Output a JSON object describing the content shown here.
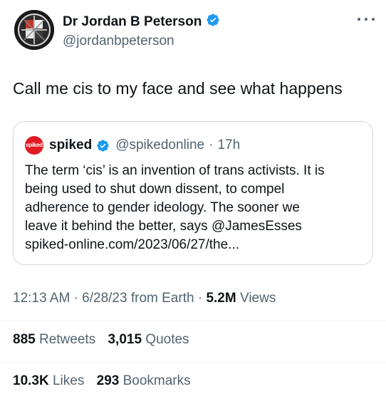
{
  "author": {
    "name": "Dr Jordan B Peterson",
    "handle": "@jordanbpeterson",
    "verified": true
  },
  "tweet": {
    "text": "Call me cis to my face and see what happens"
  },
  "quote": {
    "avatar_text": "spiked",
    "name": "spiked",
    "handle": "@spikedonline",
    "separator": "·",
    "time": "17h",
    "lines": [
      "The term ‘cis’ is an invention of trans activists. It is",
      "being used to shut down dissent, to compel",
      "adherence to gender ideology. The sooner we",
      "leave it behind the better, says @JamesEsses",
      "spiked-online.com/2023/06/27/the..."
    ]
  },
  "meta": {
    "time": "12:13 AM",
    "dot1": "·",
    "date": "6/28/23",
    "source": "from Earth",
    "dot2": "·",
    "views_count": "5.2M",
    "views_label": "Views"
  },
  "stats": {
    "retweets_count": "885",
    "retweets_label": "Retweets",
    "quotes_count": "3,015",
    "quotes_label": "Quotes",
    "likes_count": "10.3K",
    "likes_label": "Likes",
    "bookmarks_count": "293",
    "bookmarks_label": "Bookmarks"
  },
  "colors": {
    "verified": "#1d9bf0",
    "muted": "#536471",
    "text": "#0f1419",
    "border": "#cfd9de",
    "spiked_red": "#e01b24"
  }
}
